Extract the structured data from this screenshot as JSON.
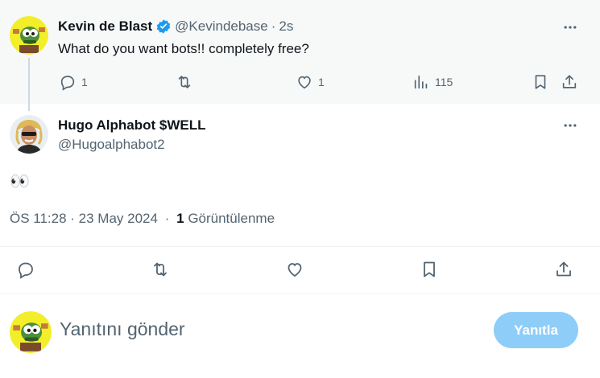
{
  "parent_tweet": {
    "display_name": "Kevin de Blast",
    "handle": "@Kevindebase",
    "separator": "·",
    "time": "2s",
    "text": "What do you want bots!! completely free?",
    "reply_count": "1",
    "retweet_count": "",
    "like_count": "1",
    "view_count": "115",
    "verified": true
  },
  "main_tweet": {
    "display_name": "Hugo Alphabot $WELL",
    "handle": "@Hugoalphabot2",
    "text": "👀",
    "timestamp": "ÖS 11:28 · 23 May 2024",
    "meta_separator": "·",
    "views_number": "1",
    "views_label": "Görüntülenme"
  },
  "reply_composer": {
    "placeholder": "Yanıtını gönder",
    "button_label": "Yanıtla"
  },
  "colors": {
    "verified_blue": "#1d9bf0",
    "reply_button_bg": "#8ecdf8",
    "muted_text": "#536471",
    "parent_bg": "#f7f9f9"
  },
  "icons": [
    "more-icon",
    "reply-icon",
    "retweet-icon",
    "like-icon",
    "views-icon",
    "bookmark-icon",
    "share-icon",
    "verified-badge-icon"
  ]
}
